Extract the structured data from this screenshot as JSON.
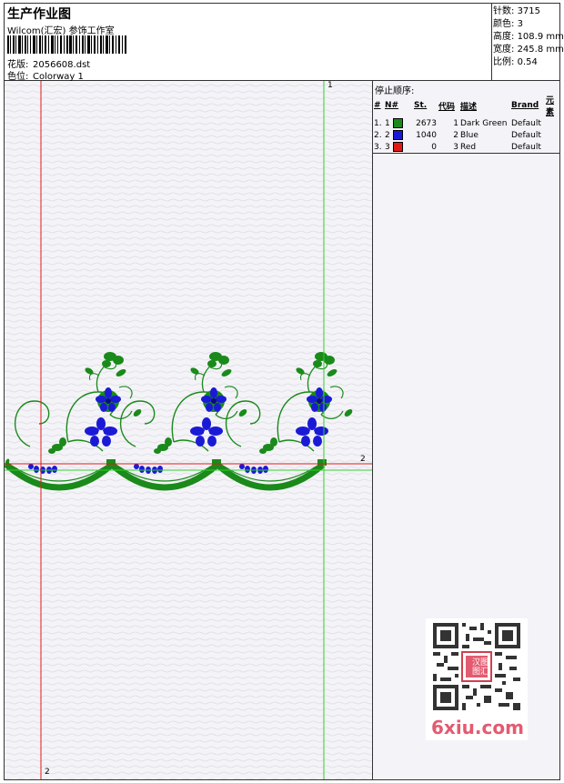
{
  "header": {
    "title": "生产作业图",
    "company": "Wilcom(汇宏) 参饰工作室",
    "design_label": "花版:",
    "design_value": "2056608.dst",
    "colorway_label": "色位:",
    "colorway_value": "Colorway 1"
  },
  "stats": {
    "stitches_label": "针数:",
    "stitches_value": "3715",
    "colors_label": "颜色:",
    "colors_value": "3",
    "height_label": "高度:",
    "height_value": "108.9 mm",
    "width_label": "宽度:",
    "width_value": "245.8 mm",
    "scale_label": "比例:",
    "scale_value": "0.54"
  },
  "stop_sequence": {
    "title": "停止顺序:",
    "columns": [
      "#",
      "N#",
      "St.",
      "代码",
      "描述",
      "Brand",
      "元素"
    ],
    "rows": [
      {
        "idx": "1.",
        "n": "1",
        "stitches": "2673",
        "code": "1",
        "desc": "Dark Green",
        "brand": "Default",
        "color": "#1a8a1a"
      },
      {
        "idx": "2.",
        "n": "2",
        "stitches": "1040",
        "code": "2",
        "desc": "Blue",
        "brand": "Default",
        "color": "#1a1ad6"
      },
      {
        "idx": "3.",
        "n": "3",
        "stitches": "0",
        "code": "3",
        "desc": "Red",
        "brand": "Default",
        "color": "#e01818"
      }
    ]
  },
  "guides": {
    "green_top_label": "1",
    "red_right_label": "2",
    "red_bottom_label": "2"
  },
  "watermark": {
    "text": "6xiu.com",
    "seal": "汉图 图汇"
  },
  "colors": {
    "green": "#1a8a1a",
    "blue": "#1a1ad6",
    "red_guide": "#e01818",
    "green_guide": "#2fd02f"
  }
}
